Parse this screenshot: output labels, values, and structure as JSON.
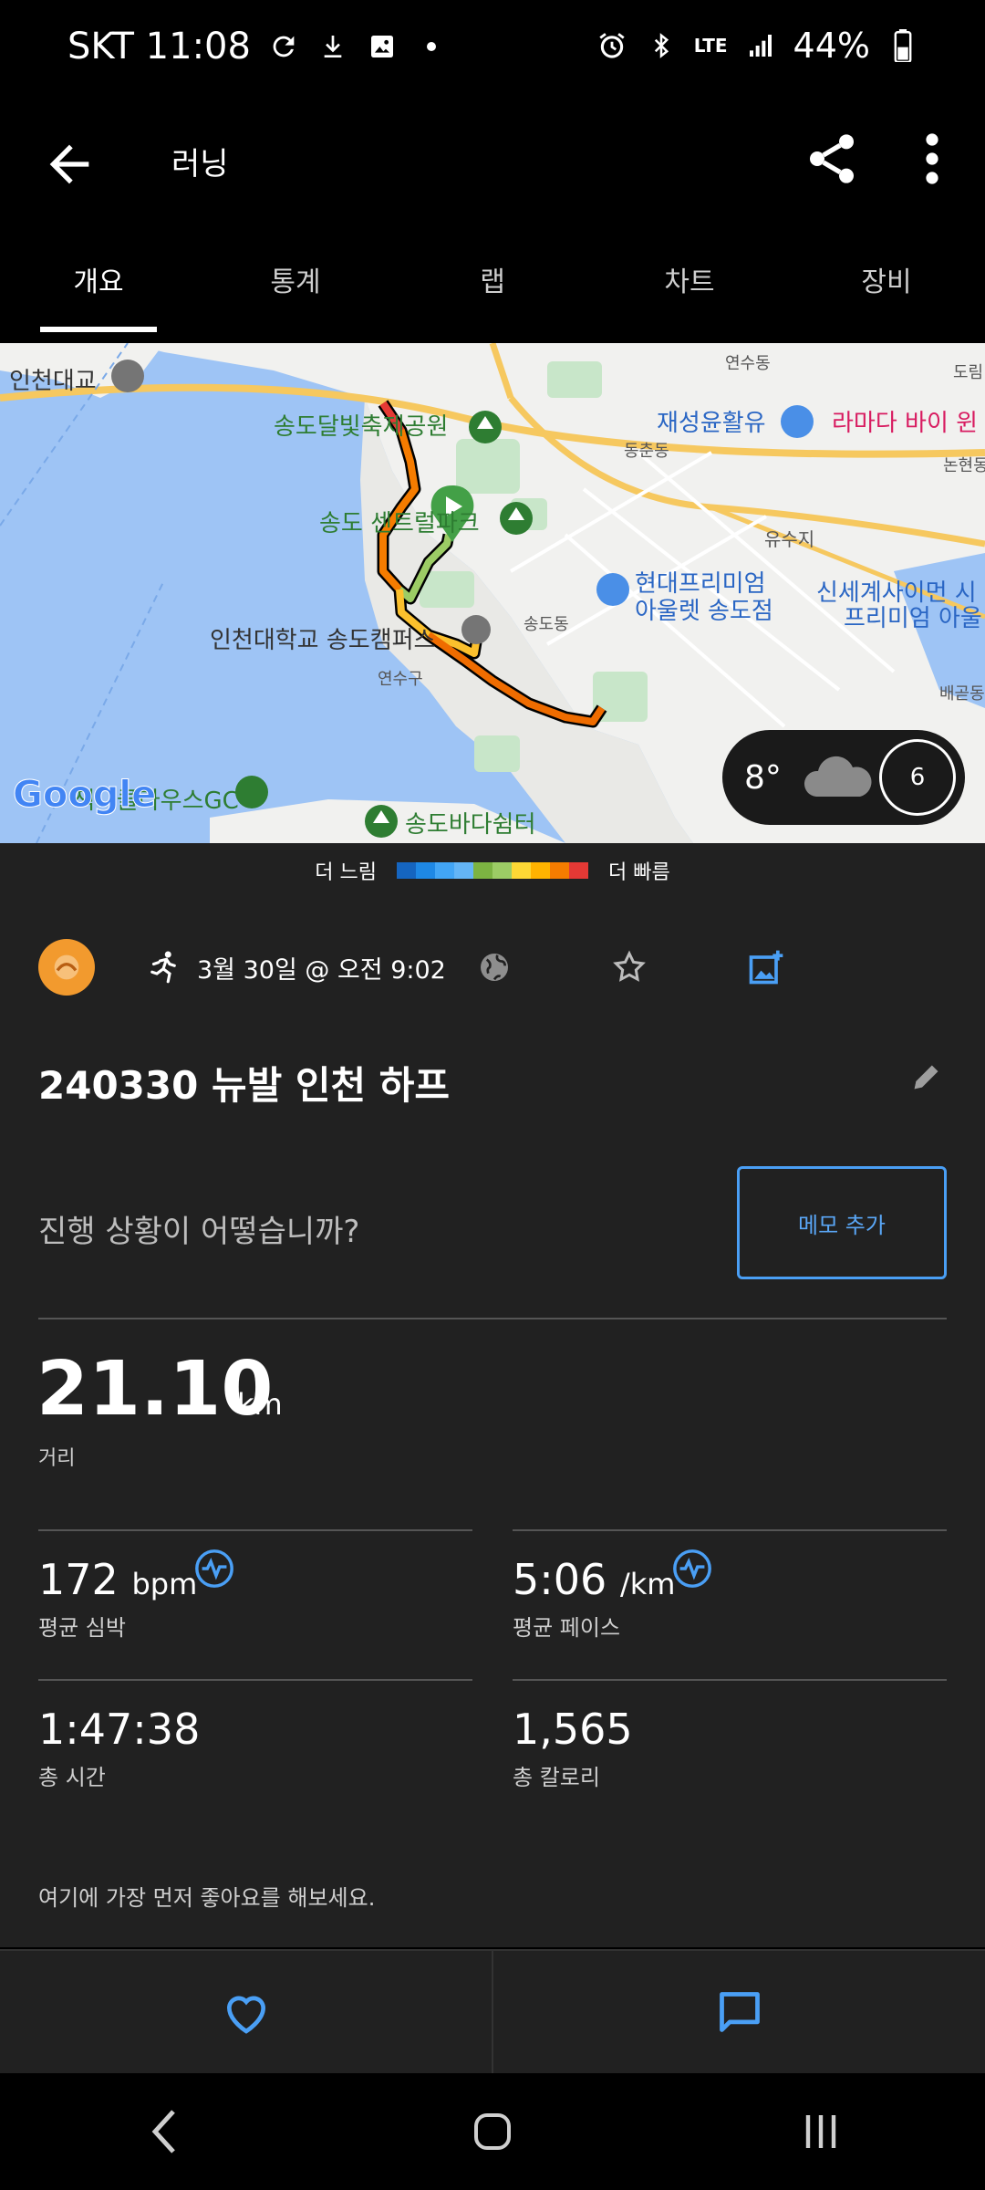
{
  "status_bar": {
    "carrier_time": "SKT 11:08",
    "network": "LTE",
    "battery": "44%"
  },
  "app_bar": {
    "title": "러닝"
  },
  "tabs": [
    {
      "label": "개요",
      "active": true
    },
    {
      "label": "통계",
      "active": false
    },
    {
      "label": "랩",
      "active": false
    },
    {
      "label": "차트",
      "active": false
    },
    {
      "label": "장비",
      "active": false
    }
  ],
  "map": {
    "labels": {
      "incheon_bridge": "인천대교",
      "songdo_moonlight": "송도달빛축제공원",
      "yeonsu_dong": "연수동",
      "dorim": "도림",
      "jaesung": "재성윤활유",
      "ramada": "라마다 바이 윈",
      "dongchun": "동춘동",
      "nonhyeon": "논현동",
      "songdo_central": "송도 센트럴파크",
      "yusuji": "유수지",
      "hyundai_outlet_1": "현대프리미엄",
      "hyundai_outlet_2": "아울렛 송도점",
      "shinsegae_1": "신세계사이먼 시",
      "shinsegae_2": "프리미엄 아울",
      "songdo_dong": "송도동",
      "incheon_univ": "인천대학교 송도캠퍼스",
      "yeonsu_gu": "연수구",
      "baegot": "배곧동",
      "golf": "잭니클라우스GC",
      "songdo_shelter": "송도바다쉼터",
      "google": "Google"
    },
    "weather": {
      "temperature": "8°",
      "wind_speed": "6",
      "icon": "cloud-icon"
    }
  },
  "legend": {
    "slow": "더 느림",
    "fast": "더 빠름",
    "colors": [
      "#1565c0",
      "#1e88e5",
      "#42a5f5",
      "#64b5f6",
      "#7cb342",
      "#9ccc65",
      "#fdd835",
      "#ffb300",
      "#f57c00",
      "#e53935"
    ]
  },
  "activity": {
    "date": "3월 30일 @ 오전 9:02",
    "title": "240330 뉴발 인천 하프",
    "prompt": "진행 상황이 어떻습니까?",
    "memo_button": "메모 추가",
    "distance": {
      "value": "21.10",
      "unit": "km",
      "label": "거리"
    },
    "stats": [
      {
        "value": "172",
        "unit": "bpm",
        "label": "평균 심박",
        "has_icon": true
      },
      {
        "value": "5:06",
        "unit": "/km",
        "label": "평균 페이스",
        "has_icon": true
      },
      {
        "value": "1:47:38",
        "unit": "",
        "label": "총 시간",
        "has_icon": false
      },
      {
        "value": "1,565",
        "unit": "",
        "label": "총 칼로리",
        "has_icon": false
      }
    ],
    "like_note": "여기에 가장 먼저 좋아요를 해보세요."
  },
  "colors": {
    "accent": "#4a9ff5",
    "avatar": "#f29a2e",
    "background": "#212121"
  }
}
